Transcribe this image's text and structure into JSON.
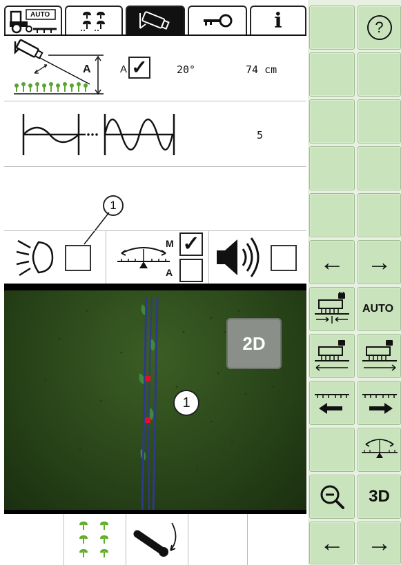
{
  "tabs": [
    {
      "name": "auto-steering",
      "label": "AUTO"
    },
    {
      "name": "crop-rows",
      "label": ""
    },
    {
      "name": "camera",
      "label": ""
    },
    {
      "name": "key",
      "label": ""
    },
    {
      "name": "info",
      "label": "i"
    }
  ],
  "camera_settings": {
    "height_label": "A",
    "checkbox_label": "A",
    "auto_checked": true,
    "angle": "20°",
    "height": "74 cm"
  },
  "sensitivity": {
    "value": "5"
  },
  "options_row": {
    "mode_manual_label": "M",
    "mode_auto_label": "A",
    "manual_checked": true,
    "auto_checked": false,
    "light_checked": false,
    "sound_checked": false
  },
  "callouts": {
    "top": "1",
    "camera": "1"
  },
  "camera_view": {
    "view_mode": "2D"
  },
  "side_panel": {
    "help": "?",
    "auto_label": "AUTO",
    "three_d_label": "3D"
  },
  "colors": {
    "key_bg": "#c9e4bd",
    "camera_bg": "#2f4f1e",
    "row_line": "#2e3a8c",
    "marker": "#e0102a"
  }
}
